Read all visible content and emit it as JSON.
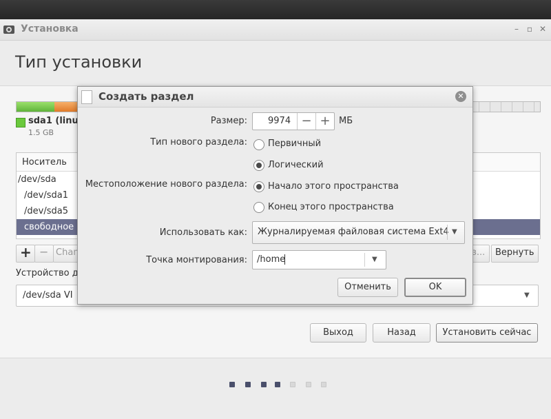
{
  "window": {
    "title": "Установка",
    "heading": "Тип установки"
  },
  "partition_bar": {
    "legend_name": "sda1 (linu",
    "legend_size": "1.5 GB",
    "colors": {
      "used_primary": "#6ac93c",
      "used_secondary": "#f09a4a",
      "free": "#e8e8e8"
    }
  },
  "table": {
    "header": "Носитель",
    "rows": [
      "/dev/sda",
      "/dev/sda1",
      "/dev/sda5",
      "свободное"
    ]
  },
  "toolbar": {
    "add": "+",
    "remove": "−",
    "change_label": "Chan",
    "hidden_label": "з...",
    "revert_label": "Вернуть"
  },
  "bootloader": {
    "label": "Устройство д",
    "value": "/dev/sda   VI"
  },
  "actions": {
    "quit": "Выход",
    "back": "Назад",
    "install": "Установить сейчас"
  },
  "progress_dots": {
    "total": 7,
    "done": 4
  },
  "dialog": {
    "title": "Создать раздел",
    "size_label": "Размер:",
    "size_value": "9974",
    "size_unit": "МБ",
    "type_label": "Тип нового раздела:",
    "type_primary": "Первичный",
    "type_logical": "Логический",
    "type_selected": "logical",
    "location_label": "Местоположение нового раздела:",
    "location_begin": "Начало этого пространства",
    "location_end": "Конец этого пространства",
    "location_selected": "begin",
    "use_as_label": "Использовать как:",
    "use_as_value": "Журналируемая файловая система Ext4",
    "mount_label": "Точка монтирования:",
    "mount_value": "/home",
    "cancel": "Отменить",
    "ok": "OK"
  },
  "colors": {
    "selection": "#6b6f8f",
    "accent_dot": "#4a4f6b"
  }
}
